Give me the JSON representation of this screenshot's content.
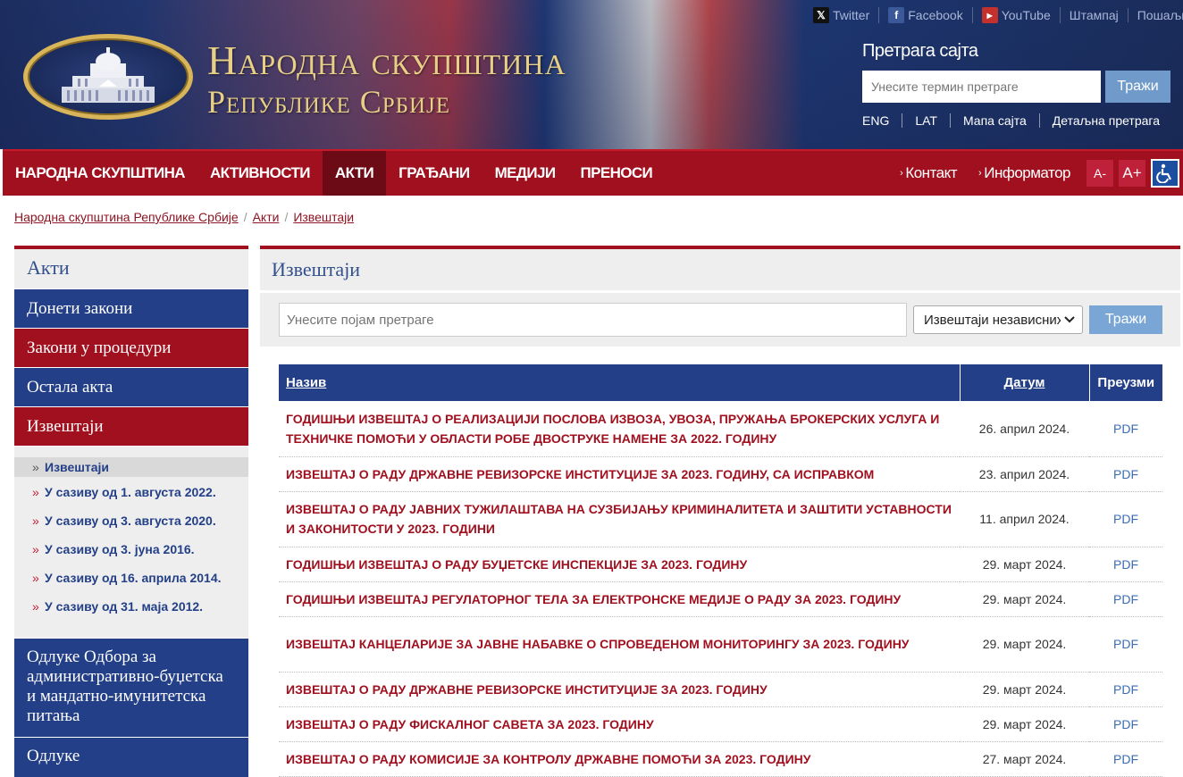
{
  "header": {
    "title_line1": "Народна скупштина",
    "title_line2": "Републике Србије",
    "social": [
      {
        "label": "Twitter",
        "icon": "x-icon"
      },
      {
        "label": "Facebook",
        "icon": "facebook-icon"
      },
      {
        "label": "YouTube",
        "icon": "youtube-icon"
      },
      {
        "label": "Штампај",
        "icon": ""
      },
      {
        "label": "Пошаљи",
        "icon": ""
      }
    ],
    "search": {
      "label": "Претрага сајта",
      "placeholder": "Унесите термин претраге",
      "button": "Тражи"
    },
    "links": [
      "ENG",
      "LAT",
      "Мапа сајта",
      "Детаљна претрага"
    ]
  },
  "nav": {
    "items": [
      "НАРОДНА СКУПШТИНА",
      "АКТИВНОСТИ",
      "АКТИ",
      "ГРАЂАНИ",
      "МЕДИЈИ",
      "ПРЕНОСИ"
    ],
    "active_index": 2,
    "contact": "Контакт",
    "informator": "Информатор",
    "font_smaller": "A-",
    "font_larger": "A+"
  },
  "breadcrumb": {
    "items": [
      "Народна скупштина Републике Србије",
      "Акти",
      "Извештаји"
    ]
  },
  "sidebar": {
    "title": "Акти",
    "items": [
      {
        "label": "Донети закони",
        "color": "blue"
      },
      {
        "label": "Закони у процедури",
        "color": "red"
      },
      {
        "label": "Остала акта",
        "color": "blue"
      },
      {
        "label": "Извештаји",
        "color": "red"
      }
    ],
    "sub_items": [
      "Извештаји",
      "У сазиву од 1. августа 2022.",
      "У сазиву од 3. августа 2020.",
      "У сазиву од 3. јуна 2016.",
      "У сазиву од 16. априла 2014.",
      "У сазиву од 31. маја 2012."
    ],
    "bottom_items": [
      "Одлуке Одбора за административно-буџетска и мандатно-имунитетска питања",
      "Одлуке"
    ]
  },
  "main": {
    "title": "Извештаји",
    "filter": {
      "placeholder": "Унесите појам претраге",
      "select_value": "Извештаји независних",
      "button": "Тражи"
    },
    "table": {
      "headers": [
        "Назив",
        "Датум",
        "Преузми"
      ],
      "rows": [
        {
          "title": "ГОДИШЊИ ИЗВЕШТАЈ О РЕАЛИЗАЦИЈИ ПОСЛОВА ИЗВОЗА, УВОЗА, ПРУЖАЊА БРОКЕРСКИХ УСЛУГА И ТЕХНИЧКЕ ПОМОЋИ У ОБЛАСТИ РОБЕ ДВОСТРУКЕ НАМЕНЕ ЗА 2022. ГОДИНУ",
          "date": "26. април 2024.",
          "download": "PDF"
        },
        {
          "title": "ИЗВЕШТАЈ О РАДУ ДРЖАВНЕ РЕВИЗОРСКЕ ИНСТИТУЦИЈЕ ЗА 2023. ГОДИНУ, СА ИСПРАВКОМ",
          "date": "23. април 2024.",
          "download": "PDF"
        },
        {
          "title": "ИЗВЕШТАЈ О РАДУ ЈАВНИХ ТУЖИЛАШТАВА НА СУЗБИЈАЊУ КРИМИНАЛИТЕТА И ЗАШТИТИ УСТАВНОСТИ И ЗАКОНИТОСТИ У 2023. ГОДИНИ",
          "date": "11. април 2024.",
          "download": "PDF"
        },
        {
          "title": "ГОДИШЊИ ИЗВЕШТАЈ О РАДУ БУЏЕТСКЕ ИНСПЕКЦИЈЕ ЗА 2023. ГОДИНУ",
          "date": "29. март 2024.",
          "download": "PDF"
        },
        {
          "title": "ГОДИШЊИ ИЗВЕШТАЈ РЕГУЛАТОРНОГ ТЕЛА ЗА ЕЛЕКТРОНСКЕ МЕДИЈЕ О РАДУ ЗА 2023. ГОДИНУ",
          "date": "29. март 2024.",
          "download": "PDF"
        },
        {
          "title": "ИЗВЕШТАЈ КАНЦЕЛАРИЈЕ ЗА ЈАВНЕ НАБАВКЕ О СПРОВЕДЕНОМ МОНИТОРИНГУ ЗА 2023. ГОДИНУ",
          "date": "29. март 2024.",
          "download": "PDF"
        },
        {
          "title": "ИЗВЕШТАЈ О РАДУ ДРЖАВНЕ РЕВИЗОРСКЕ ИНСТИТУЦИЈЕ ЗА 2023. ГОДИНУ",
          "date": "29. март 2024.",
          "download": "PDF"
        },
        {
          "title": "ИЗВЕШТАЈ О РАДУ ФИСКАЛНОГ САВЕТА ЗА 2023. ГОДИНУ",
          "date": "29. март 2024.",
          "download": "PDF"
        },
        {
          "title": "ИЗВЕШТАЈ О РАДУ КОМИСИЈЕ ЗА КОНТРОЛУ ДРЖАВНЕ ПОМОЋИ ЗА 2023. ГОДИНУ",
          "date": "27. март 2024.",
          "download": "PDF"
        }
      ]
    }
  },
  "colors": {
    "nav_red": "#a0101f",
    "nav_active": "#6c0b15",
    "side_blue": "#233f87",
    "title_blue": "#33508d",
    "link_red": "#8f1422",
    "pdf_blue": "#3b6db5",
    "button_blue": "#7aa6d6"
  }
}
